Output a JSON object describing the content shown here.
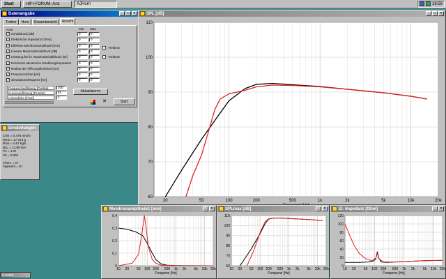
{
  "taskbar": {
    "start": "Start",
    "tasks": [
      "HIFI-FORUM: Anz",
      "AJHorn"
    ],
    "clock": "18:59"
  },
  "params_window": {
    "title": "Datenangabe",
    "tabs": [
      "Treiber",
      "Horn",
      "Gesamtansicht",
      "Ansicht"
    ],
    "section_label": "Auto",
    "col_min": "Min",
    "col_max": "Max",
    "checks": [
      "Schalldruck [dB]",
      "Elektrische Impedanz [Ohm]",
      "Effektive Membranamplitude [mm]",
      "Lineare Maximalschalldruck [dB]",
      "Leistung für lin. Maximalschalldruck [W]",
      "Normierte akustische Strahlungsimpedanz",
      "Radius der Öffnungsfunktion [cm]",
      "Frequenzachse [Hz]",
      "Simulationsfrequenz [Hz]"
    ],
    "min_vals": [
      "0",
      "0",
      "0",
      "0",
      "0",
      "0",
      "0",
      "0",
      "0"
    ],
    "max_vals": [
      "0",
      "0",
      "0",
      "0",
      "0",
      "0",
      "0",
      "0",
      "0"
    ],
    "treiber1": "Treiber2",
    "treiber2": "Treiber2",
    "settings": [
      {
        "label": "Frequenzauflösung [Punkte]",
        "value": "100"
      },
      {
        "label": "Kurvenauflösung [Punkte]",
        "value": "51"
      },
      {
        "label": "Liniendicke [Pixel]",
        "value": "2"
      }
    ],
    "update_button": "Aktualisieren",
    "start_button": "Start"
  },
  "driver_window": {
    "title": "Einstellungen",
    "lines": [
      "Cms = 0.478 mm/N",
      "Mms = 17.374 g",
      "Rms = 4.57 kg/s",
      "BxL = 12.99 N/A",
      "Pe = 1 W",
      "Sh = 0.264",
      "",
      "Vhorn = 0 l",
      "Vgesamt = 8 l"
    ]
  },
  "spl_window": {
    "title": "SPL [dB]"
  },
  "exc_window": {
    "title": "Membranamplitude1 [mm]"
  },
  "spl2_window": {
    "title": "SPLmax [dB]"
  },
  "imp_window": {
    "title": "El. Impedanz [Ohm]"
  },
  "min_window": {
    "title": "Einstell..."
  },
  "chart_data": [
    {
      "type": "line",
      "title": "",
      "xlabel": "Frequenz [Hz]",
      "ylabel": "",
      "xscale": "log",
      "xlim": [
        15,
        20000
      ],
      "ylim": [
        60,
        110
      ],
      "x_ticks": [
        20,
        50,
        100,
        200,
        500,
        1000,
        2000,
        5000,
        10000,
        20000
      ],
      "x_tick_labels": [
        "20",
        "50",
        "100",
        "200",
        "500",
        "1k",
        "2k",
        "5k",
        "10k",
        "20k"
      ],
      "y_ticks": [
        60,
        70,
        80,
        90,
        100,
        110
      ],
      "series": [
        {
          "color": "#000000",
          "x": [
            15,
            20,
            30,
            50,
            80,
            100,
            150,
            200,
            300,
            500,
            1000,
            2000,
            5000,
            10000,
            15000
          ],
          "y": [
            53,
            60,
            67.5,
            76.5,
            84,
            87.5,
            91,
            92.2,
            92.5,
            92.1,
            91.6,
            90.8,
            89.8,
            88.8,
            88
          ]
        },
        {
          "color": "#e02020",
          "x": [
            30,
            40,
            50,
            60,
            70,
            80,
            100,
            150,
            200,
            300,
            500,
            1000,
            2000,
            5000,
            10000,
            15000
          ],
          "y": [
            56,
            66,
            72,
            79,
            85,
            88,
            89.5,
            90.5,
            91.5,
            92,
            91.9,
            91.5,
            90.8,
            89.8,
            88.8,
            88
          ]
        }
      ]
    },
    {
      "type": "line",
      "title": "",
      "xlabel": "Frequenz [Hz]",
      "ylabel": "",
      "xscale": "log",
      "xlim": [
        10,
        20000
      ],
      "ylim": [
        0,
        0.4
      ],
      "x_ticks": [
        10,
        20,
        50,
        100,
        200,
        500,
        1000,
        2000,
        5000,
        10000,
        20000
      ],
      "x_tick_labels": [
        "10",
        "20",
        "50",
        "100",
        "200",
        "500",
        "1k",
        "2k",
        "5k",
        "10k",
        "20k"
      ],
      "y_ticks": [
        0,
        0.1,
        0.2,
        0.3,
        0.4
      ],
      "y_tick_labels": [
        "0",
        "0.1",
        "0.2",
        "0.3",
        "0.4"
      ],
      "series": [
        {
          "color": "#000000",
          "x": [
            10,
            20,
            40,
            70,
            100,
            150,
            200,
            300,
            500,
            1000,
            20000
          ],
          "y": [
            0.3,
            0.29,
            0.27,
            0.24,
            0.18,
            0.1,
            0.05,
            0.015,
            0.004,
            0.001,
            0
          ]
        },
        {
          "color": "#e02020",
          "x": [
            10,
            30,
            50,
            65,
            80,
            90,
            110,
            150,
            200,
            300,
            1000,
            20000
          ],
          "y": [
            0,
            0.02,
            0.09,
            0.25,
            0.4,
            0.32,
            0.15,
            0.05,
            0.02,
            0.005,
            0,
            0
          ]
        }
      ]
    },
    {
      "type": "line",
      "title": "",
      "xlabel": "Frequenz [Hz]",
      "ylabel": "",
      "xscale": "log",
      "xlim": [
        10,
        20000
      ],
      "ylim": [
        60,
        110
      ],
      "x_ticks": [
        10,
        20,
        50,
        100,
        200,
        500,
        1000,
        2000,
        5000,
        10000,
        20000
      ],
      "x_tick_labels": [
        "10",
        "20",
        "50",
        "100",
        "200",
        "500",
        "1k",
        "2k",
        "5k",
        "10k",
        "20k"
      ],
      "y_ticks": [
        60,
        70,
        80,
        90,
        100,
        110
      ],
      "series": [
        {
          "color": "#000000",
          "x": [
            20,
            50,
            100,
            150,
            200,
            300,
            500,
            1000,
            5000,
            15000
          ],
          "y": [
            60,
            77,
            92,
            102,
            106.5,
            107.5,
            107.5,
            107,
            106,
            105
          ]
        },
        {
          "color": "#e02020",
          "x": [
            35,
            60,
            100,
            150,
            200,
            300,
            500,
            1000,
            5000,
            15000
          ],
          "y": [
            60,
            75,
            93,
            104,
            106.8,
            107.5,
            107.5,
            107,
            106,
            105
          ]
        }
      ]
    },
    {
      "type": "line",
      "title": "",
      "xlabel": "Frequenz [Hz]",
      "ylabel": "",
      "xscale": "log",
      "xlim": [
        10,
        20000
      ],
      "ylim": [
        0,
        120
      ],
      "x_ticks": [
        10,
        20,
        50,
        100,
        200,
        500,
        1000,
        2000,
        5000,
        10000,
        20000
      ],
      "x_tick_labels": [
        "10",
        "20",
        "50",
        "100",
        "200",
        "500",
        "1k",
        "2k",
        "5k",
        "10k",
        "20k"
      ],
      "y_ticks": [
        0,
        20,
        40,
        60,
        80,
        100,
        120
      ],
      "series": [
        {
          "color": "#000000",
          "x": [
            10,
            30,
            60,
            90,
            110,
            125,
            140,
            170,
            250,
            500,
            1000,
            5000,
            20000
          ],
          "y": [
            8,
            8,
            9,
            11,
            16,
            34,
            18,
            9,
            8,
            9,
            10,
            12,
            13
          ]
        },
        {
          "color": "#e02020",
          "x": [
            10,
            15,
            20,
            30,
            50,
            80,
            110,
            125,
            140,
            200,
            500,
            1000,
            5000,
            20000
          ],
          "y": [
            100,
            70,
            50,
            30,
            17,
            12,
            18,
            30,
            17,
            9,
            9,
            10,
            12,
            13
          ]
        }
      ]
    }
  ]
}
